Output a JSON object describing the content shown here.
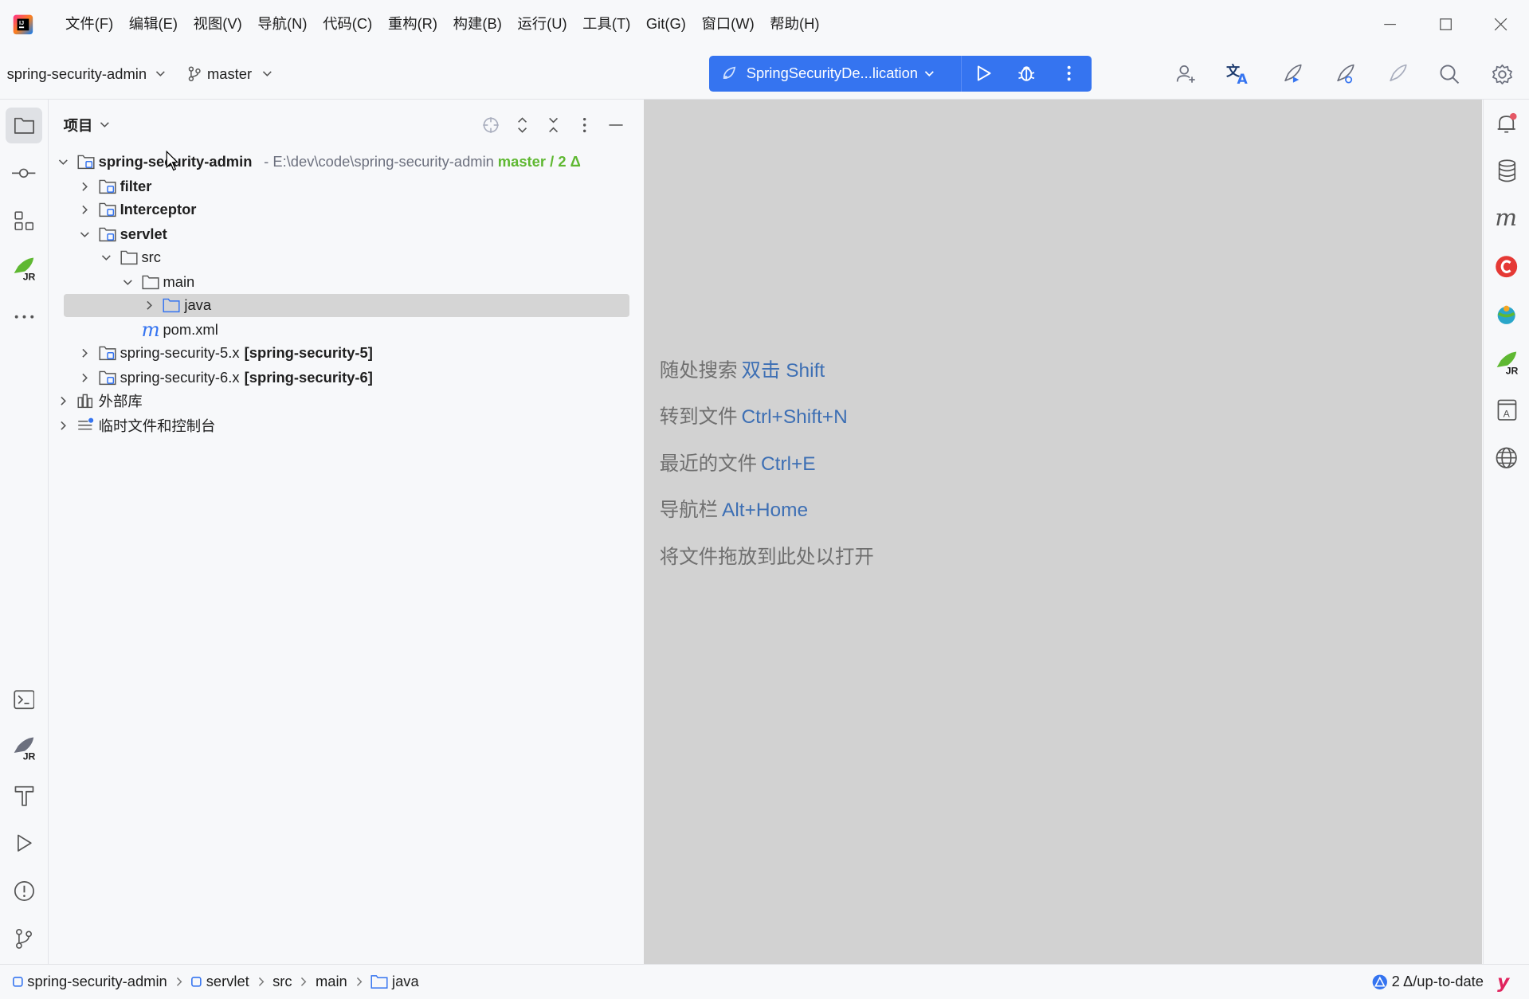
{
  "menu": [
    "文件(F)",
    "编辑(E)",
    "视图(V)",
    "导航(N)",
    "代码(C)",
    "重构(R)",
    "构建(B)",
    "运行(U)",
    "工具(T)",
    "Git(G)",
    "窗口(W)",
    "帮助(H)"
  ],
  "toolbar": {
    "project_name": "spring-security-admin",
    "branch": "master",
    "run_config": "SpringSecurityDe...lication"
  },
  "panel": {
    "title": "项目"
  },
  "tree": {
    "root_name": "spring-security-admin",
    "root_path": "- E:\\dev\\code\\spring-security-admin",
    "root_vcs": "master / 2 Δ",
    "filter": "filter",
    "interceptor": "Interceptor",
    "servlet": "servlet",
    "src": "src",
    "main": "main",
    "java": "java",
    "pom": "pom.xml",
    "ss5_name": "spring-security-5.x",
    "ss5_module": "[spring-security-5]",
    "ss6_name": "spring-security-6.x",
    "ss6_module": "[spring-security-6]",
    "external_libs": "外部库",
    "scratches": "临时文件和控制台"
  },
  "editor_hints": [
    {
      "text": "随处搜索",
      "key": "双击 Shift"
    },
    {
      "text": "转到文件",
      "key": "Ctrl+Shift+N"
    },
    {
      "text": "最近的文件",
      "key": "Ctrl+E"
    },
    {
      "text": "导航栏",
      "key": "Alt+Home"
    },
    {
      "text": "将文件拖放到此处以打开",
      "key": ""
    }
  ],
  "breadcrumbs": [
    "spring-security-admin",
    "servlet",
    "src",
    "main",
    "java"
  ],
  "status": {
    "vcs": "2 Δ/up-to-date"
  },
  "colors": {
    "accent": "#3574f0",
    "vcs_green": "#5fb832",
    "editor_bg": "#d2d2d2"
  },
  "icons": {
    "left_strip": [
      "folder-icon",
      "commit-icon",
      "structure-icon",
      "jrebel-icon",
      "more-icon",
      "terminal-icon",
      "jrebel-panel-icon",
      "build-icon",
      "run-icon",
      "problems-icon",
      "git-icon"
    ],
    "right_strip": [
      "notifications-icon",
      "database-icon",
      "maven-icon",
      "codota-icon",
      "plugin-icon",
      "jrebel-icon",
      "dictionary-icon",
      "globe-icon"
    ]
  }
}
